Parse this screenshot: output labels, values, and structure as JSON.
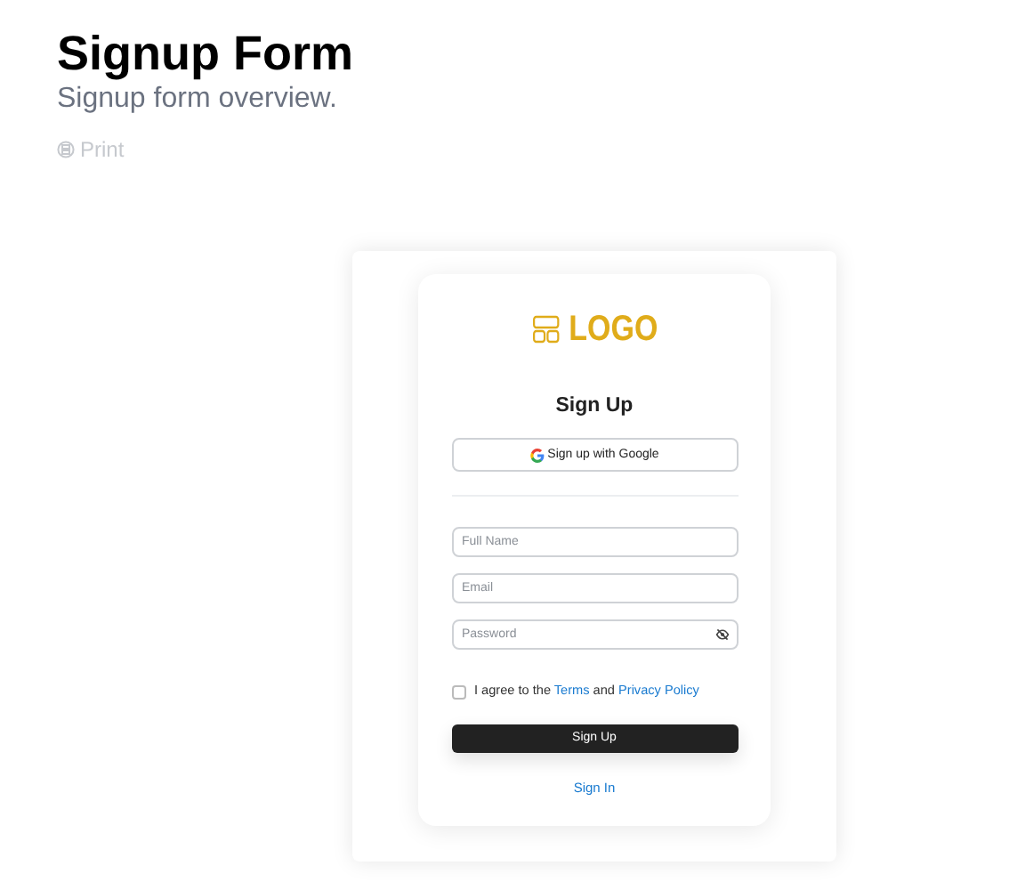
{
  "header": {
    "title": "Signup Form",
    "subtitle": "Signup form overview.",
    "print_label": "Print"
  },
  "form": {
    "logo_text": "LOGO",
    "heading": "Sign Up",
    "google_button": "Sign up with Google",
    "fields": [
      {
        "placeholder": "Full Name",
        "kind": "text"
      },
      {
        "placeholder": "Email",
        "kind": "text"
      },
      {
        "placeholder": "Password",
        "kind": "password"
      }
    ],
    "agreement": {
      "checked": false,
      "text_before": "I agree to the",
      "terms_link": "Terms",
      "text_between": "and",
      "privacy_link": "Privacy Policy"
    },
    "submit_button": "Sign Up",
    "signin_link": "Sign In"
  }
}
